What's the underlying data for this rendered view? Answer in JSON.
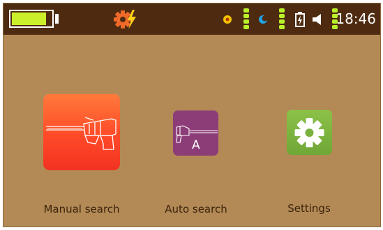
{
  "status_bar": {
    "battery_level": 0.87,
    "clock": "18:46",
    "colors": {
      "background": "#4e2b10",
      "battery_fill": "#cbef2b",
      "settings_gear": "#ef6a2a",
      "bolt": "#ffd11a",
      "signal_bar": "#b8f22a"
    },
    "icons": [
      "settings-gear-bolt-icon",
      "yellow-dot-icon",
      "blue-moon-icon",
      "battery-charging-icon",
      "speaker-icon"
    ]
  },
  "apps": [
    {
      "label": "Manual search",
      "icon": "detector-probe-icon"
    },
    {
      "label": "Auto search",
      "icon": "detector-probe-auto-icon",
      "badge": "A"
    },
    {
      "label": "Settings",
      "icon": "gear-icon"
    }
  ],
  "colors": {
    "screen_background": "#b38a55",
    "label_text": "#3b220d"
  }
}
